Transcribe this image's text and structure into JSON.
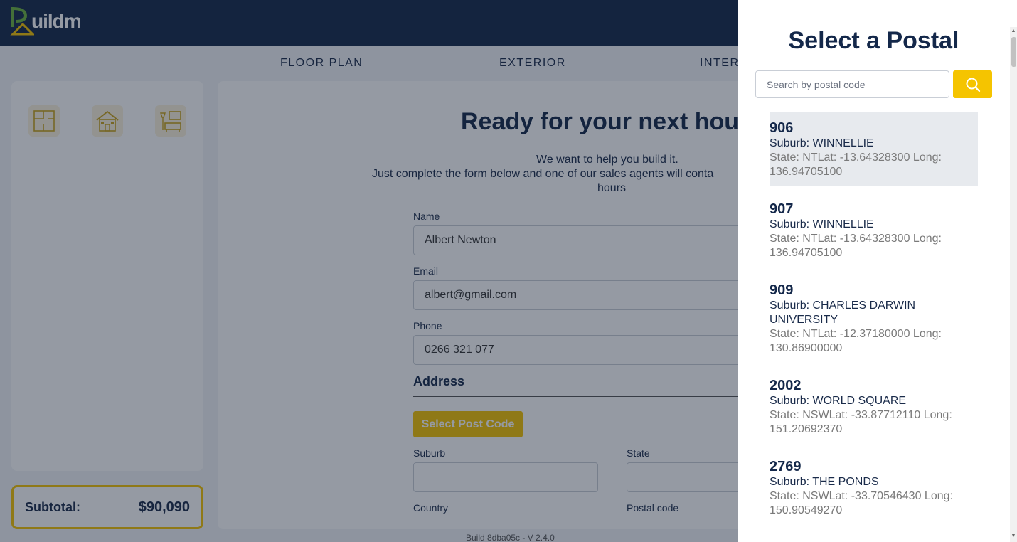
{
  "brand": {
    "name": "uildm",
    "accent": "#f5c400",
    "navy": "#14284a"
  },
  "nav": {
    "items": [
      "FLOOR PLAN",
      "EXTERIOR",
      "INTER"
    ]
  },
  "left_panel": {
    "icons": [
      "floor-plan-icon",
      "house-exterior-icon",
      "interior-furniture-icon"
    ]
  },
  "subtotal": {
    "label": "Subtotal:",
    "value": "$90,090"
  },
  "form": {
    "title": "Ready for your next hous",
    "line1": "We want to help you build it.",
    "line2": "Just complete the form below and one of our sales agents will conta",
    "line3": "hours",
    "name_label": "Name",
    "name_value": "Albert Newton",
    "email_label": "Email",
    "email_value": "albert@gmail.com",
    "phone_label": "Phone",
    "phone_value": "0266 321 077",
    "address_title": "Address",
    "postcode_button": "Select Post Code",
    "suburb_label": "Suburb",
    "state_label": "State",
    "country_label": "Country",
    "postal_label": "Postal code"
  },
  "footer": {
    "build": "Build 8dba05c - V 2.4.0"
  },
  "drawer": {
    "title": "Select a Postal",
    "search_placeholder": "Search by postal code",
    "items": [
      {
        "code": "906",
        "suburb": "Suburb: WINNELLIE",
        "meta1": "State: NTLat: -13.64328300 Long:",
        "meta2": "136.94705100",
        "selected": true
      },
      {
        "code": "907",
        "suburb": "Suburb: WINNELLIE",
        "meta1": "State: NTLat: -13.64328300 Long:",
        "meta2": "136.94705100",
        "selected": false
      },
      {
        "code": "909",
        "suburb": "Suburb: CHARLES DARWIN",
        "suburb2": "UNIVERSITY",
        "meta1": "State: NTLat: -12.37180000 Long:",
        "meta2": "130.86900000",
        "selected": false
      },
      {
        "code": "2002",
        "suburb": "Suburb: WORLD SQUARE",
        "meta1": "State: NSWLat: -33.87712110 Long:",
        "meta2": "151.20692370",
        "selected": false
      },
      {
        "code": "2769",
        "suburb": "Suburb: THE PONDS",
        "meta1": "State: NSWLat: -33.70546430 Long:",
        "meta2": "150.90549270",
        "selected": false
      }
    ]
  }
}
